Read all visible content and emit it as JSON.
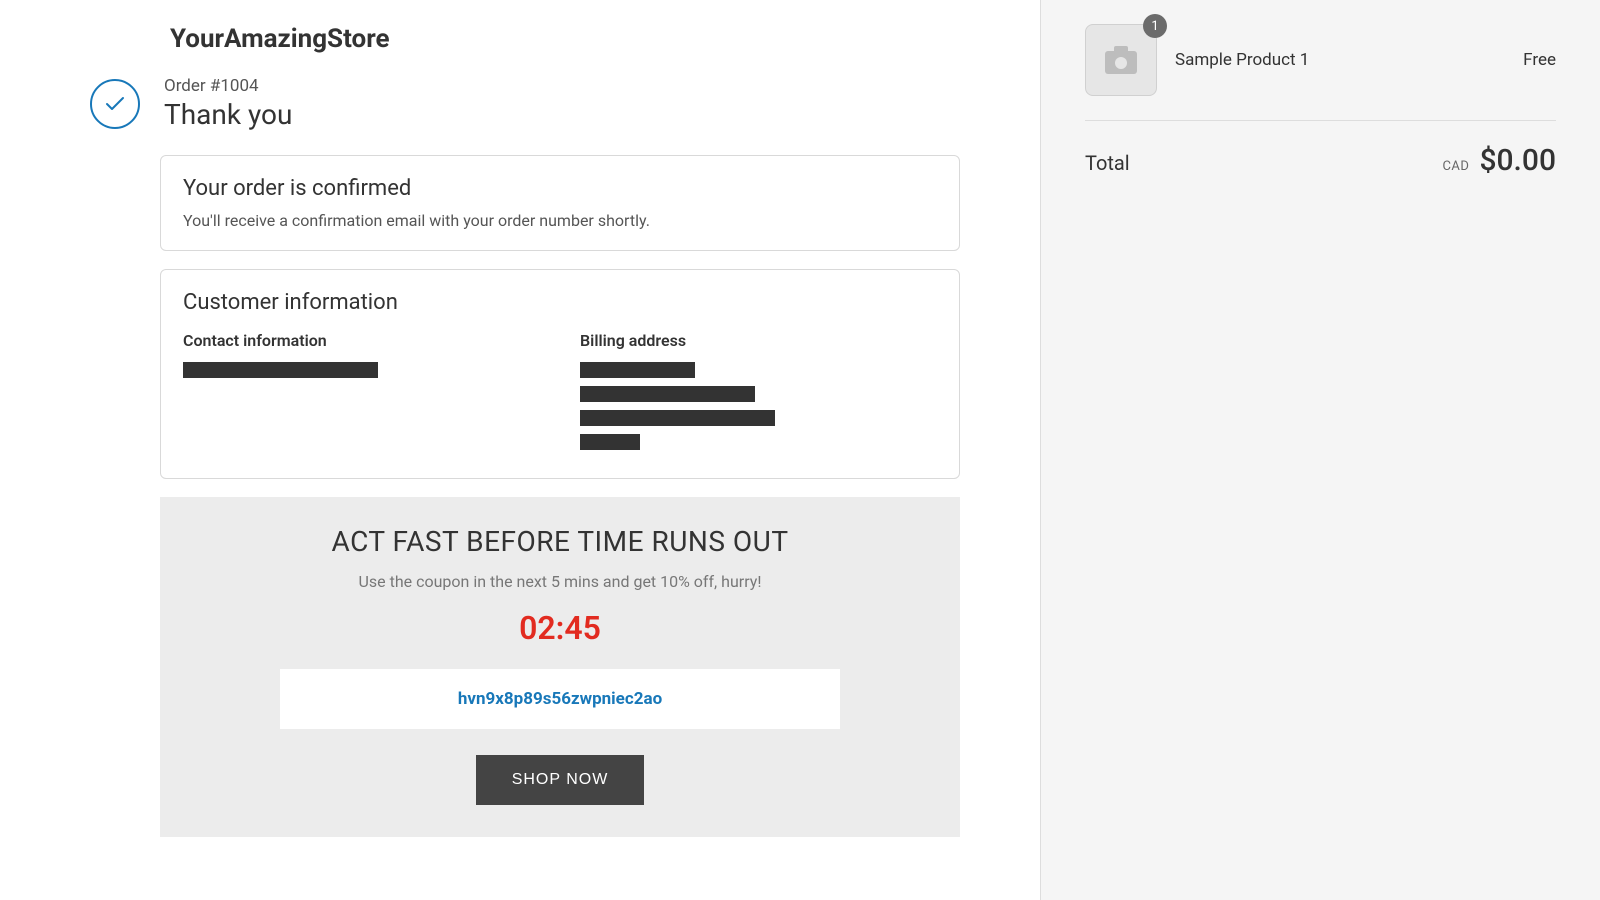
{
  "store": {
    "name": "YourAmazingStore"
  },
  "order": {
    "number_label": "Order #1004",
    "thank_you": "Thank you",
    "confirmed_title": "Your order is confirmed",
    "confirmed_sub": "You'll receive a confirmation email with your order number shortly."
  },
  "customer": {
    "title": "Customer information",
    "contact_label": "Contact information",
    "billing_label": "Billing address"
  },
  "promo": {
    "title": "ACT FAST BEFORE TIME RUNS OUT",
    "sub": "Use the coupon in the next 5 mins and get 10% off, hurry!",
    "timer": "02:45",
    "coupon": "hvn9x8p89s56zwpniec2ao",
    "button": "SHOP NOW"
  },
  "cart": {
    "items": [
      {
        "qty": "1",
        "name": "Sample Product 1",
        "price": "Free"
      }
    ],
    "total_label": "Total",
    "currency": "CAD",
    "total_amount": "$0.00"
  }
}
